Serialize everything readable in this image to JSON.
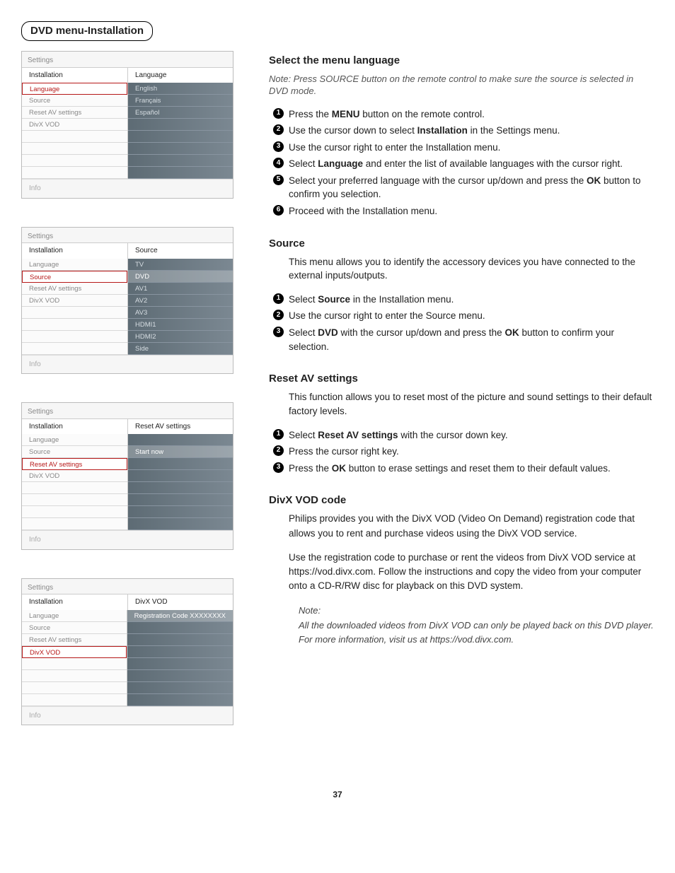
{
  "page_tab": "DVD menu-Installation",
  "page_number": "37",
  "menus": [
    {
      "title": "Settings",
      "header_left": "Installation",
      "header_right": "Language",
      "left_items": [
        "Language",
        "Source",
        "Reset AV settings",
        "DivX VOD",
        "",
        "",
        "",
        ""
      ],
      "left_selected": 0,
      "right_items": [
        "English",
        "Français",
        "Español",
        "",
        "",
        "",
        "",
        ""
      ],
      "right_highlight": -1,
      "footer": "Info"
    },
    {
      "title": "Settings",
      "header_left": "Installation",
      "header_right": "Source",
      "left_items": [
        "Language",
        "Source",
        "Reset AV settings",
        "DivX VOD",
        "",
        "",
        "",
        ""
      ],
      "left_selected": 1,
      "right_items": [
        "TV",
        "DVD",
        "AV1",
        "AV2",
        "AV3",
        "HDMI1",
        "HDMI2",
        "Side"
      ],
      "right_highlight": 1,
      "footer": "Info"
    },
    {
      "title": "Settings",
      "header_left": "Installation",
      "header_right": "Reset AV settings",
      "left_items": [
        "Language",
        "Source",
        "Reset AV settings",
        "DivX VOD",
        "",
        "",
        "",
        ""
      ],
      "left_selected": 2,
      "right_items": [
        "",
        "Start now",
        "",
        "",
        "",
        "",
        "",
        ""
      ],
      "right_highlight": 1,
      "footer": "Info"
    },
    {
      "title": "Settings",
      "header_left": "Installation",
      "header_right": "DivX VOD",
      "left_items": [
        "Language",
        "Source",
        "Reset AV settings",
        "DivX VOD",
        "",
        "",
        "",
        ""
      ],
      "left_selected": 3,
      "right_items": [
        "Registration Code XXXXXXXX",
        "",
        "",
        "",
        "",
        "",
        "",
        ""
      ],
      "right_highlight": 0,
      "footer": "Info"
    }
  ],
  "sections": {
    "lang": {
      "heading": "Select the menu language",
      "note": "Note: Press SOURCE button on the remote control to make sure the source is selected in DVD mode.",
      "steps": [
        [
          [
            "Press the "
          ],
          [
            "b",
            "MENU"
          ],
          [
            " button on the remote control."
          ]
        ],
        [
          [
            "Use the cursor down to select "
          ],
          [
            "b",
            "Installation"
          ],
          [
            " in the Settings menu."
          ]
        ],
        [
          [
            "Use the cursor right to enter the Installation menu."
          ]
        ],
        [
          [
            "Select "
          ],
          [
            "b",
            "Language"
          ],
          [
            " and enter the list of available languages with the cursor right."
          ]
        ],
        [
          [
            "Select your preferred language with the cursor up/down and press the "
          ],
          [
            "b",
            "OK"
          ],
          [
            " button to confirm you selection."
          ]
        ],
        [
          [
            "Proceed with the Installation menu."
          ]
        ]
      ]
    },
    "source": {
      "heading": "Source",
      "intro": "This menu allows you to identify the accessory devices you have connected to the external inputs/outputs.",
      "steps": [
        [
          [
            "Select "
          ],
          [
            "b",
            "Source"
          ],
          [
            " in the Installation menu."
          ]
        ],
        [
          [
            "Use the cursor right to enter the Source menu."
          ]
        ],
        [
          [
            "Select "
          ],
          [
            "b",
            "DVD"
          ],
          [
            " with the cursor up/down and press the "
          ],
          [
            "b",
            "OK"
          ],
          [
            " button to confirm your selection."
          ]
        ]
      ]
    },
    "reset": {
      "heading": "Reset AV settings",
      "intro": "This function allows you to reset most of the picture and sound settings to their default factory levels.",
      "steps": [
        [
          [
            "Select "
          ],
          [
            "b",
            "Reset AV settings"
          ],
          [
            " with the cursor down key."
          ]
        ],
        [
          [
            "Press the cursor right key."
          ]
        ],
        [
          [
            "Press the "
          ],
          [
            "b",
            "OK"
          ],
          [
            " button to erase settings and reset them to their default values."
          ]
        ]
      ]
    },
    "divx": {
      "heading": "DivX VOD code",
      "p1": "Philips provides you with the DivX VOD (Video On Demand) registration code that allows you to rent and purchase videos using the DivX VOD service.",
      "p2": "Use the registration code to purchase or rent the videos from DivX VOD service at https://vod.divx.com. Follow the instructions and copy the video from your computer onto a CD-R/RW disc for playback on this DVD system.",
      "note_hd": "Note:",
      "note_body": "All the downloaded videos from DivX VOD can only be played back on this DVD player. For more information, visit us at https://vod.divx.com."
    }
  }
}
